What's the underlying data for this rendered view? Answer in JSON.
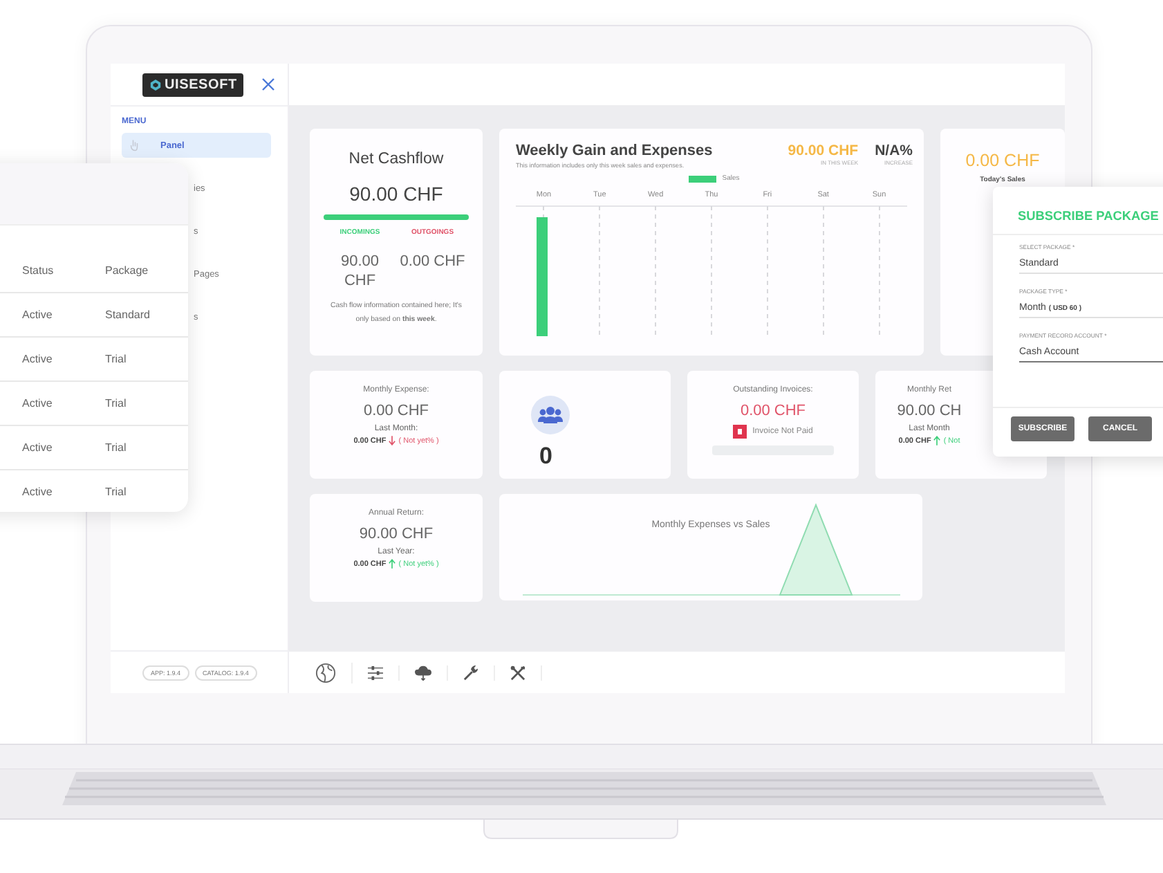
{
  "header": {
    "logo": "UISESOFT"
  },
  "sidebar": {
    "title": "MENU",
    "items": [
      {
        "label": "Panel",
        "selected": true
      },
      {
        "label": "ies",
        "selected": false
      },
      {
        "label": "s",
        "selected": false
      },
      {
        "label": "Pages",
        "selected": false
      },
      {
        "label": "s",
        "selected": false
      }
    ],
    "versions": [
      "APP: 1.9.4",
      "CATALOG: 1.9.4"
    ]
  },
  "net_cashflow": {
    "title": "Net Cashflow",
    "amount": "90.00 CHF",
    "level": 1,
    "incomings_label": "INCOMINGS",
    "outgoings_label": "OUTGOINGS",
    "incomings": "90.00 CHF",
    "outgoings": "0.00 CHF",
    "note": "Cash flow information contained here; It's only based on **this week**."
  },
  "weekly": {
    "title": "Weekly Gain and Expenses",
    "subtitle": "This information includes only this week sales and expenses.",
    "amount": "90.00 CHF",
    "amount_caption": "IN THIS WEEK",
    "increase": "N/A%",
    "increase_caption": "INCREASE",
    "legend": "Sales",
    "days": [
      "Mon",
      "Tue",
      "Wed",
      "Thu",
      "Fri",
      "Sat",
      "Sun"
    ]
  },
  "today_sales": {
    "amount": "0.00 CHF",
    "caption": "Today's Sales"
  },
  "stat_rows": [
    [
      {
        "kind": "comparison",
        "title": "Monthly Expense:",
        "amount": "0.00 CHF",
        "previous_label": "Last Month:",
        "previous": "0.00 CHF",
        "rising": false,
        "change": "( Not yet% )"
      },
      {
        "kind": "count",
        "count": "0"
      },
      {
        "kind": "invoices",
        "title": "Outstanding Invoices:",
        "amount": "0.00 CHF",
        "status": "Invoice Not Paid",
        "level": 0
      },
      {
        "kind": "comparison",
        "title": "Monthly Ret",
        "amount": "90.00 CH",
        "previous_label": "Last Month",
        "previous": "0.00 CHF",
        "rising": true,
        "change": "( Not"
      }
    ],
    [
      {
        "kind": "comparison",
        "title": "Annual Return:",
        "amount": "90.00 CHF",
        "previous_label": "Last Year:",
        "previous": "0.00 CHF",
        "rising": true,
        "change": "( Not yet% )"
      },
      {
        "kind": "chart",
        "title": "Monthly Expenses vs Sales"
      }
    ]
  ],
  "table": {
    "columns": [
      "Status",
      "Package"
    ],
    "rows": [
      [
        "Active",
        "Standard"
      ],
      [
        "Active",
        "Trial"
      ],
      [
        "Active",
        "Trial"
      ],
      [
        "Active",
        "Trial"
      ],
      [
        "Active",
        "Trial"
      ]
    ]
  },
  "modal": {
    "title": "SUBSCRIBE PACKAGE",
    "fields": [
      {
        "label": "SELECT PACKAGE *",
        "value": "Standard",
        "focused": false
      },
      {
        "label": "PACKAGE TYPE *",
        "value": "Month **( USD 60 )**",
        "focused": false
      },
      {
        "label": "PAYMENT RECORD ACCOUNT *",
        "value": "Cash Account",
        "focused": true
      }
    ],
    "buttons": [
      "SUBSCRIBE",
      "CANCEL"
    ]
  }
}
